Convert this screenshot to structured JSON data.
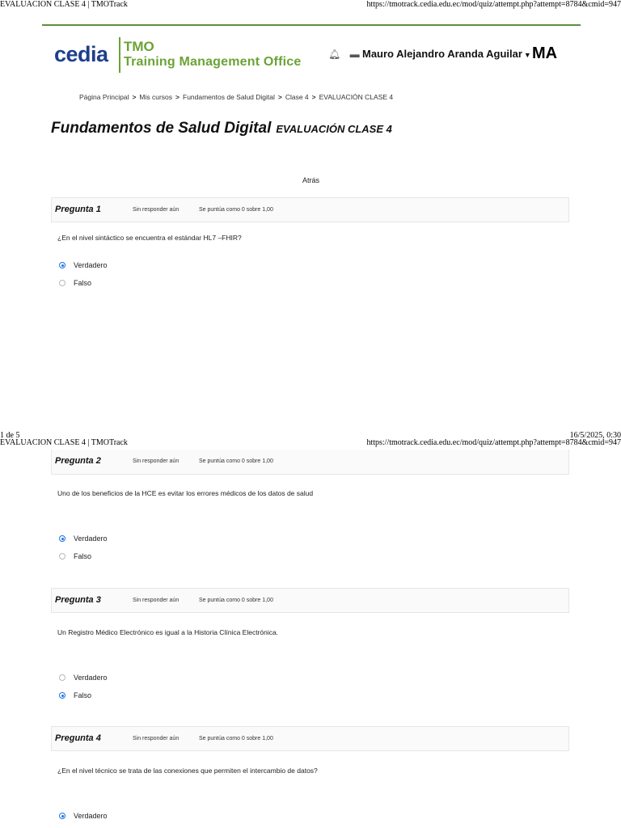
{
  "page1": {
    "print_title": "EVALUACION CLASE 4 | TMOTrack",
    "print_url": "https://tmotrack.cedia.edu.ec/mod/quiz/attempt.php?attempt=8784&cmid=947",
    "footer_page": "1 de 5",
    "footer_datetime": "16/5/2025, 0:30"
  },
  "page2": {
    "print_title": "EVALUACION CLASE 4 | TMOTrack",
    "print_url": "https://tmotrack.cedia.edu.ec/mod/quiz/attempt.php?attempt=8784&cmid=947"
  },
  "logo": {
    "brand": "cedia",
    "tmo": "TMO",
    "subtitle": "Training Management Office"
  },
  "header": {
    "user_name": "Mauro Alejandro Aranda Aguilar",
    "initials": "MA",
    "icons": [
      "bell-icon",
      "chat-icon"
    ]
  },
  "breadcrumb": [
    "Página Principal",
    "Mis cursos",
    "Fundamentos de Salud Digital",
    "Clase 4",
    "EVALUACIÓN CLASE 4"
  ],
  "title": {
    "course": "Fundamentos de Salud Digital",
    "quiz": "EVALUACIÓN CLASE 4"
  },
  "nav": {
    "back": "Atrás"
  },
  "questions": [
    {
      "number": "Pregunta 1",
      "state": "Sin responder aún",
      "grade": "Se puntúa como 0 sobre 1,00",
      "text": "¿En el nivel sintáctico se encuentra el estándar HL7 –FHIR?",
      "options": [
        {
          "label": "Verdadero",
          "selected": true
        },
        {
          "label": "Falso",
          "selected": false
        }
      ]
    },
    {
      "number": "Pregunta 2",
      "state": "Sin responder aún",
      "grade": "Se puntúa como 0 sobre 1,00",
      "text": "Uno de los beneficios de la HCE es evitar los errores médicos de los datos de salud",
      "options": [
        {
          "label": "Verdadero",
          "selected": true
        },
        {
          "label": "Falso",
          "selected": false
        }
      ]
    },
    {
      "number": "Pregunta 3",
      "state": "Sin responder aún",
      "grade": "Se puntúa como 0 sobre 1,00",
      "text": "Un Registro Médico Electrónico es igual a la Historia Clínica Electrónica.",
      "options": [
        {
          "label": "Verdadero",
          "selected": false
        },
        {
          "label": "Falso",
          "selected": true
        }
      ]
    },
    {
      "number": "Pregunta 4",
      "state": "Sin responder aún",
      "grade": "Se puntúa como 0 sobre 1,00",
      "text": "¿En el nivel técnico se trata de las conexiones que permiten el intercambio de datos?",
      "options": [
        {
          "label": "Verdadero",
          "selected": true
        }
      ]
    }
  ],
  "colors": {
    "accent_green": "#6aa336",
    "brand_blue": "#1f3f8c",
    "radio_selected": "#1a73e8"
  }
}
